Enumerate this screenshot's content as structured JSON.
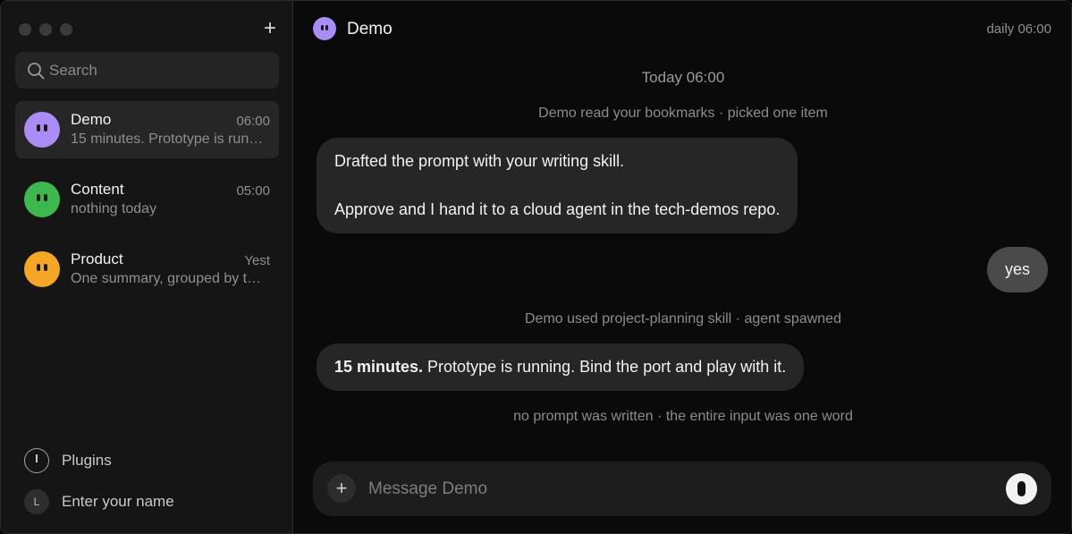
{
  "sidebar": {
    "search_placeholder": "Search",
    "conversations": [
      {
        "name": "Demo",
        "time": "06:00",
        "preview": "15 minutes. Prototype is running. Bind the port and play with it.",
        "color": "#a98cf5"
      },
      {
        "name": "Content",
        "time": "05:00",
        "preview": "nothing today",
        "color": "#3db84f"
      },
      {
        "name": "Product",
        "time": "Yest",
        "preview": "One summary, grouped by topic",
        "color": "#f5a623"
      }
    ],
    "plugins_label": "Plugins",
    "user_initial": "L",
    "user_label": "Enter your name"
  },
  "header": {
    "title": "Demo",
    "schedule": "daily 06:00"
  },
  "chat": {
    "date_divider": "Today 06:00",
    "event_1": "Demo read your bookmarks · picked one item",
    "msg_1_line1": "Drafted the prompt with your writing skill.",
    "msg_1_line2": "Approve and I hand it to a cloud agent in the tech-demos repo.",
    "reply": "yes",
    "event_2": "Demo used project-planning skill · agent spawned",
    "msg_2_bold": "15 minutes.",
    "msg_2_rest": " Prototype is running. Bind the port and play with it.",
    "event_3": "no prompt was written · the entire input was one word"
  },
  "composer": {
    "placeholder": "Message Demo"
  },
  "icons": {
    "new_chat": "+",
    "attach": "+"
  }
}
